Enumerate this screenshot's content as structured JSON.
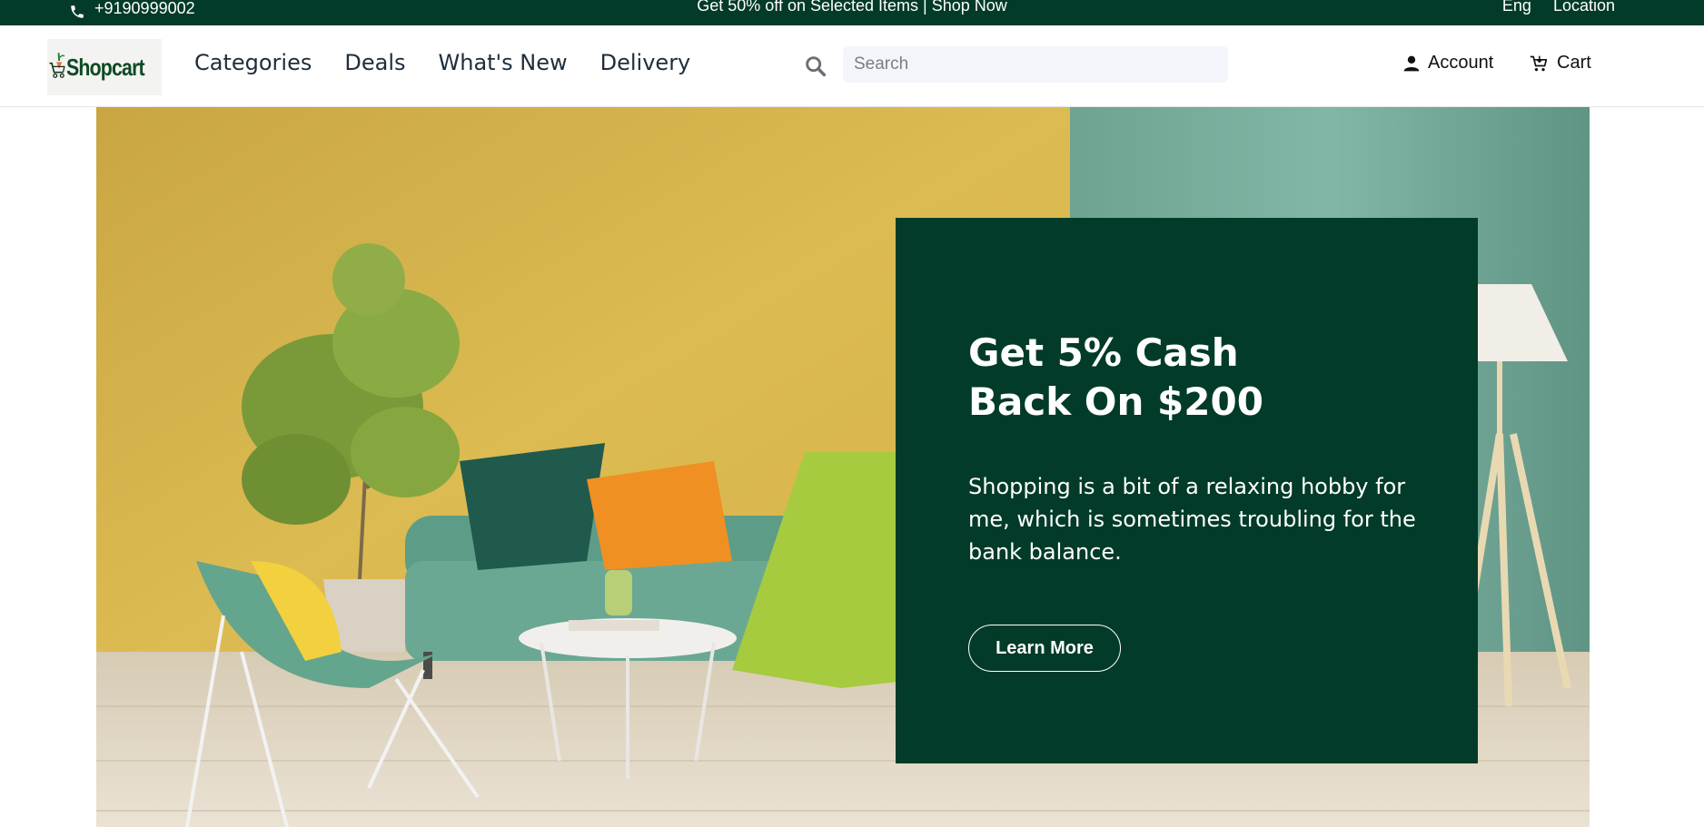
{
  "topbar": {
    "phone": "+9190999002",
    "promo": "Get 50% off on Selected Items | Shop Now",
    "language": "Eng",
    "location": "Location"
  },
  "header": {
    "brand": "Shopcart",
    "nav": [
      "Categories",
      "Deals",
      "What's New",
      "Delivery"
    ],
    "search_placeholder": "Search",
    "account_label": "Account",
    "cart_label": "Cart"
  },
  "hero": {
    "headline_line1": "Get 5% Cash",
    "headline_line2": "Back On $200",
    "body": "Shopping is a bit of a relaxing hobby for me, which is sometimes troubling for the bank balance.",
    "cta_label": "Learn More"
  },
  "colors": {
    "brand_dark_green": "#023b29",
    "wall_yellow": "#d8b84e",
    "wall_teal": "#6fa999",
    "floor": "#e2d8c6"
  }
}
